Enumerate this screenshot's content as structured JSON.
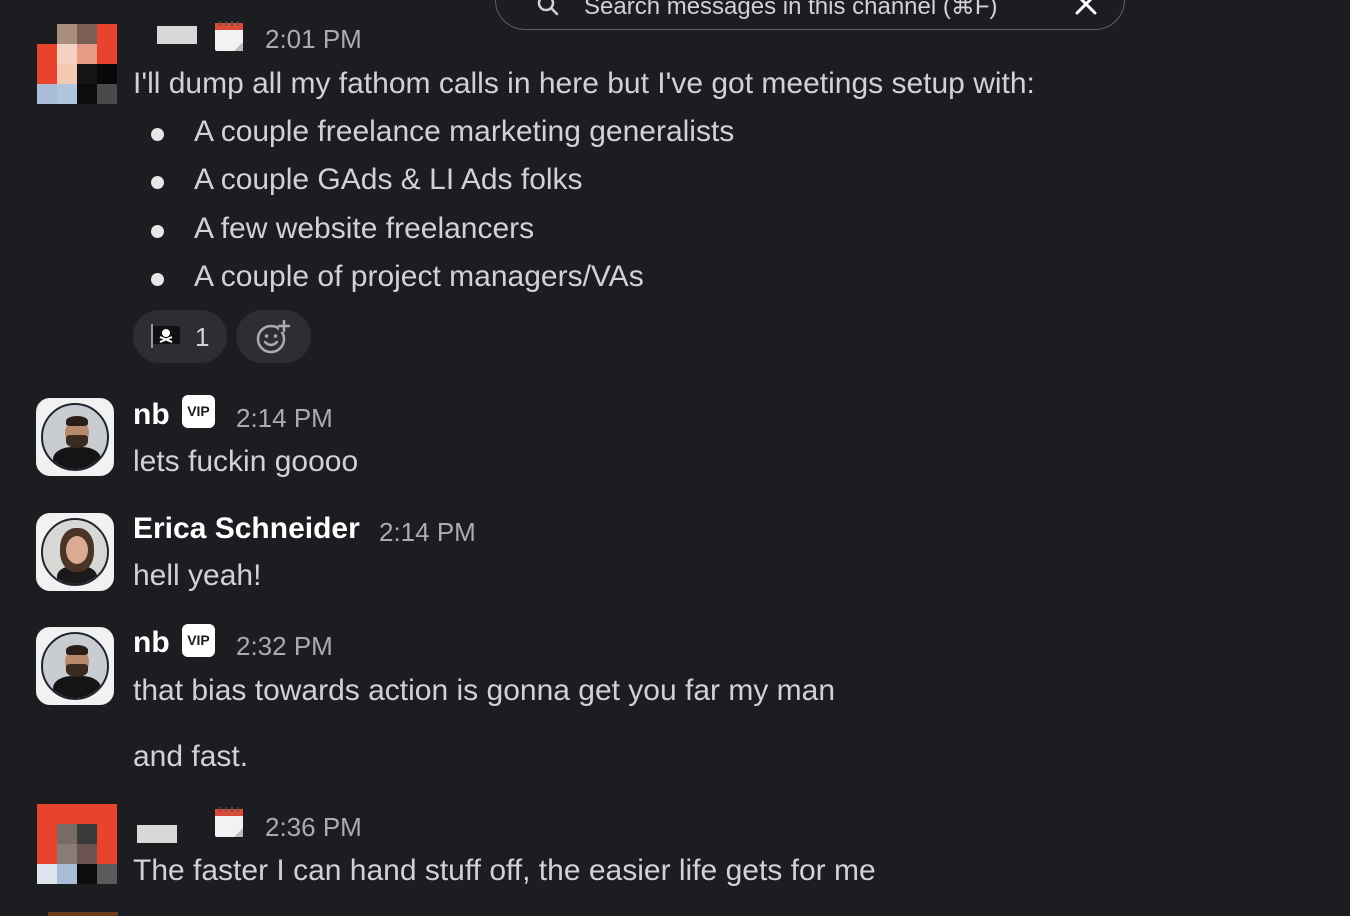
{
  "search": {
    "text": "Search messages in this channel (⌘F)"
  },
  "messages": [
    {
      "time": "2:01 PM",
      "intro": "I'll dump all my fathom calls in here but I've got meetings setup with:",
      "bullets": [
        "A couple freelance marketing generalists",
        "A couple GAds & LI Ads folks",
        "A few website freelancers",
        "A couple of project managers/VAs"
      ],
      "reaction": {
        "emoji": "pirate-flag-icon",
        "count": "1"
      }
    },
    {
      "name": "nb",
      "badge": "VIP",
      "time": "2:14 PM",
      "text": "lets fuckin goooo"
    },
    {
      "name": "Erica Schneider",
      "time": "2:14 PM",
      "text": "hell yeah!"
    },
    {
      "name": "nb",
      "badge": "VIP",
      "time": "2:32 PM",
      "lines": [
        "that bias towards action is gonna get you far my man",
        "and fast."
      ]
    },
    {
      "time": "2:36 PM",
      "text": "The faster I can hand stuff off, the easier life gets for me"
    }
  ],
  "colors": {
    "background": "#1b1d21",
    "text": "#d1d2d3",
    "timestamp": "#abacae",
    "name": "#ffffff",
    "pill": "#2c2e33"
  }
}
